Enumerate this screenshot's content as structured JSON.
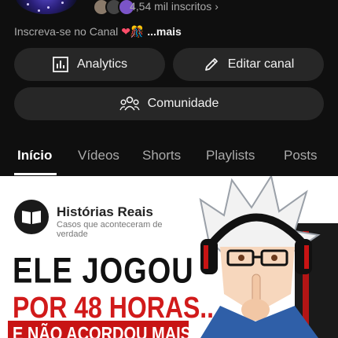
{
  "channel": {
    "subscribers": "4,54 mil inscritos",
    "description_prefix": "Inscreva-se no Canal",
    "description_more": "...mais"
  },
  "actions": {
    "analytics_label": "Analytics",
    "edit_label": "Editar canal",
    "community_label": "Comunidade"
  },
  "tabs": [
    {
      "label": "Início",
      "active": true
    },
    {
      "label": "Vídeos",
      "active": false
    },
    {
      "label": "Shorts",
      "active": false
    },
    {
      "label": "Playlists",
      "active": false
    },
    {
      "label": "Posts",
      "active": false
    }
  ],
  "thumbnail": {
    "brand_name": "Histórias Reais",
    "brand_tagline": "Casos que aconteceram de verdade",
    "headline_line1": "ELE JOGOU",
    "headline_line2": "POR 48 HORAS...",
    "headline_line3": "E NÃO ACORDOU MAIS"
  },
  "icons": [
    "analytics-icon",
    "edit-pencil-icon",
    "community-icon",
    "book-icon",
    "chevron-right-icon",
    "heart-icon"
  ],
  "colors": {
    "background": "#0f0f0f",
    "button_bg": "#272727",
    "headline_red": "#d11a1a"
  }
}
